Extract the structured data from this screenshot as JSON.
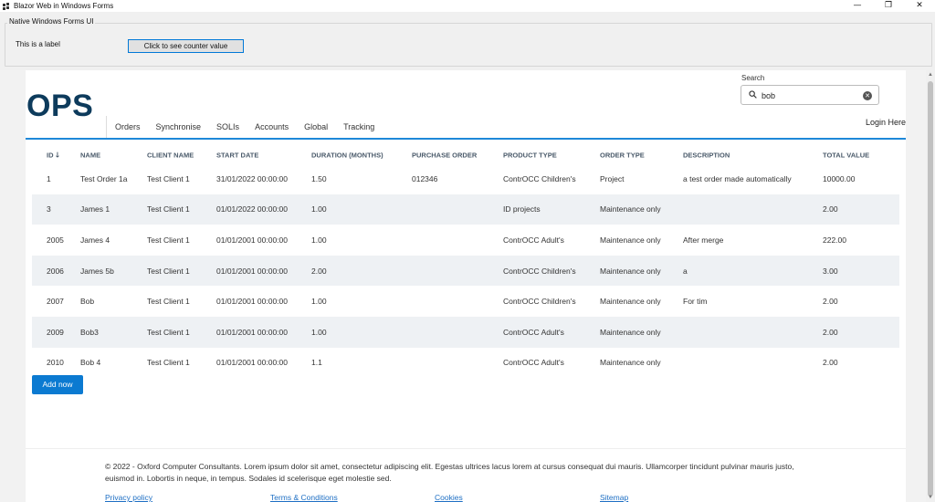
{
  "window": {
    "title": "Blazor Web in Windows Forms",
    "controls": {
      "minimize": "—",
      "restore": "❐",
      "close": "✕"
    }
  },
  "native": {
    "group_title": "Native Windows Forms UI",
    "label": "This is a label",
    "button": "Click to see counter value"
  },
  "web": {
    "logo": "OPS",
    "nav": [
      "Orders",
      "Synchronise",
      "SOLIs",
      "Accounts",
      "Global",
      "Tracking"
    ],
    "login": "Login Here",
    "search": {
      "label": "Search",
      "value": "bob"
    },
    "table": {
      "headers": [
        "ID",
        "NAME",
        "CLIENT NAME",
        "START DATE",
        "DURATION (MONTHS)",
        "PURCHASE ORDER",
        "PRODUCT TYPE",
        "ORDER TYPE",
        "DESCRIPTION",
        "TOTAL VALUE"
      ],
      "sort_indicator": "↓",
      "rows": [
        [
          "1",
          "Test Order 1a",
          "Test Client 1",
          "31/01/2022 00:00:00",
          "1.50",
          "012346",
          "ContrOCC Children's",
          "Project",
          "a test order made automatically",
          "10000.00"
        ],
        [
          "3",
          "James 1",
          "Test Client 1",
          "01/01/2022 00:00:00",
          "1.00",
          "",
          "ID projects",
          "Maintenance only",
          "",
          "2.00"
        ],
        [
          "2005",
          "James 4",
          "Test Client 1",
          "01/01/2001 00:00:00",
          "1.00",
          "",
          "ContrOCC Adult's",
          "Maintenance only",
          "After merge",
          "222.00"
        ],
        [
          "2006",
          "James 5b",
          "Test Client 1",
          "01/01/2001 00:00:00",
          "2.00",
          "",
          "ContrOCC Children's",
          "Maintenance only",
          "a",
          "3.00"
        ],
        [
          "2007",
          "Bob",
          "Test Client 1",
          "01/01/2001 00:00:00",
          "1.00",
          "",
          "ContrOCC Children's",
          "Maintenance only",
          "For tim",
          "2.00"
        ],
        [
          "2009",
          "Bob3",
          "Test Client 1",
          "01/01/2001 00:00:00",
          "1.00",
          "",
          "ContrOCC Adult's",
          "Maintenance only",
          "",
          "2.00"
        ],
        [
          "2010",
          "Bob 4",
          "Test Client 1",
          "01/01/2001 00:00:00",
          "1.1",
          "",
          "ContrOCC Adult's",
          "Maintenance only",
          "",
          "2.00"
        ]
      ]
    },
    "add_button": "Add now",
    "footer": {
      "text": "© 2022 - Oxford Computer Consultants. Lorem ipsum dolor sit amet, consectetur adipiscing elit. Egestas ultrices lacus lorem at cursus consequat dui mauris. Ullamcorper tincidunt pulvinar mauris justo, euismod in. Lobortis in neque, in tempus. Sodales id scelerisque eget molestie sed.",
      "links": [
        "Privacy policy",
        "Terms & Conditions",
        "Cookies",
        "Sitemap"
      ]
    }
  },
  "colors": {
    "accent": "#1e88d8",
    "logo": "#0d3b5c",
    "button": "#0b7ad1",
    "row_alt": "#eef1f4"
  }
}
